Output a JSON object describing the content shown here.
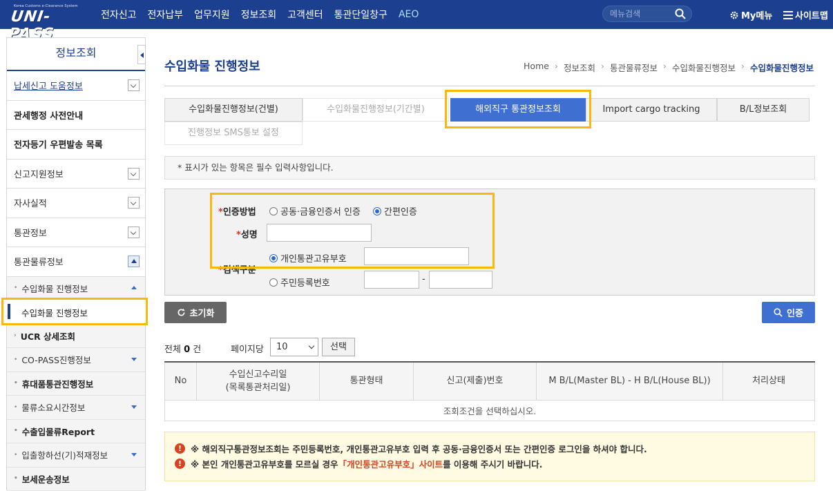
{
  "header": {
    "logo_tagline": "Korea Customs e-Clearance System",
    "logo_text": "UNI-PASS",
    "nav": [
      "전자신고",
      "전자납부",
      "업무지원",
      "정보조회",
      "고객센터",
      "통관단일창구",
      "AEO"
    ],
    "search_placeholder": "메뉴검색",
    "mymenu": "My메뉴",
    "sitemap": "사이트맵"
  },
  "sidebar": {
    "title": "정보조회",
    "items": [
      {
        "label": "납세신고 도움정보"
      },
      {
        "label": "관세행정 사전안내"
      },
      {
        "label": "전자등기 우편발송 목록"
      },
      {
        "label": "신고지원정보"
      },
      {
        "label": "자사실적"
      },
      {
        "label": "통관정보"
      },
      {
        "label": "통관물류정보"
      }
    ],
    "sub": [
      {
        "label": "수입화물 진행정보"
      },
      {
        "label": "수입화물 진행정보"
      },
      {
        "label": "UCR 상세조회"
      },
      {
        "label": "CO-PASS진행정보"
      },
      {
        "label": "휴대품통관진행정보"
      },
      {
        "label": "물류소요시간정보"
      },
      {
        "label": "수출입물류Report"
      },
      {
        "label": "입출항하선(기)적재정보"
      },
      {
        "label": "보세운송정보"
      }
    ]
  },
  "page": {
    "title": "수입화물 진행정보",
    "breadcrumb": [
      "Home",
      "정보조회",
      "통관물류정보",
      "수입화물진행정보",
      "수입화물진행정보"
    ]
  },
  "tabs": [
    {
      "label": "수입화물진행정보(건별)"
    },
    {
      "label": "수입화물진행정보(기간별)"
    },
    {
      "label": "해외직구 통관정보조회"
    },
    {
      "label": "Import cargo tracking"
    },
    {
      "label": "B/L정보조회"
    },
    {
      "label": "진행정보 SMS통보 설정"
    }
  ],
  "notice": "* 표시가 있는 항목은 필수 입력사항입니다.",
  "form": {
    "required_mark": "*",
    "auth_label": "인증방법",
    "auth_options": [
      "공동·금융인증서 인증",
      "간편인증"
    ],
    "name_label": "성명",
    "search_label": "검색구분",
    "search_options": [
      "개인통관고유부호",
      "주민등록번호"
    ],
    "id_dash": "-"
  },
  "buttons": {
    "reset": "초기화",
    "auth": "인증",
    "select": "선택"
  },
  "list": {
    "total_prefix": "전체",
    "total_count": "0",
    "total_suffix": "건",
    "perpage_label": "페이지당",
    "perpage_value": "10",
    "columns": [
      "No",
      "수입신고수리일",
      "(목록통관처리일)",
      "통관형태",
      "신고(제출)번호",
      "M B/L(Master BL) - H B/L(House BL))",
      "처리상태"
    ],
    "empty_message": "조회조건을 선택하십시오."
  },
  "warnings": {
    "line1": "※ 해외직구통관정보조회는 주민등록번호, 개인통관고유부호 입력 후 공동·금융인증서 또는 간편인증 로그인을 하셔야 합니다.",
    "line2_pre": "※ 본인 개인통관고유부호를 모르실 경우",
    "line2_link": "「개인통관고유부호」사이트",
    "line2_post": "를 이용해 주시기 바랍니다."
  },
  "colors": {
    "brand": "#1d3f8f",
    "accent": "#3f6fd1",
    "highlight": "#f8b90b",
    "required": "#e0301e"
  }
}
